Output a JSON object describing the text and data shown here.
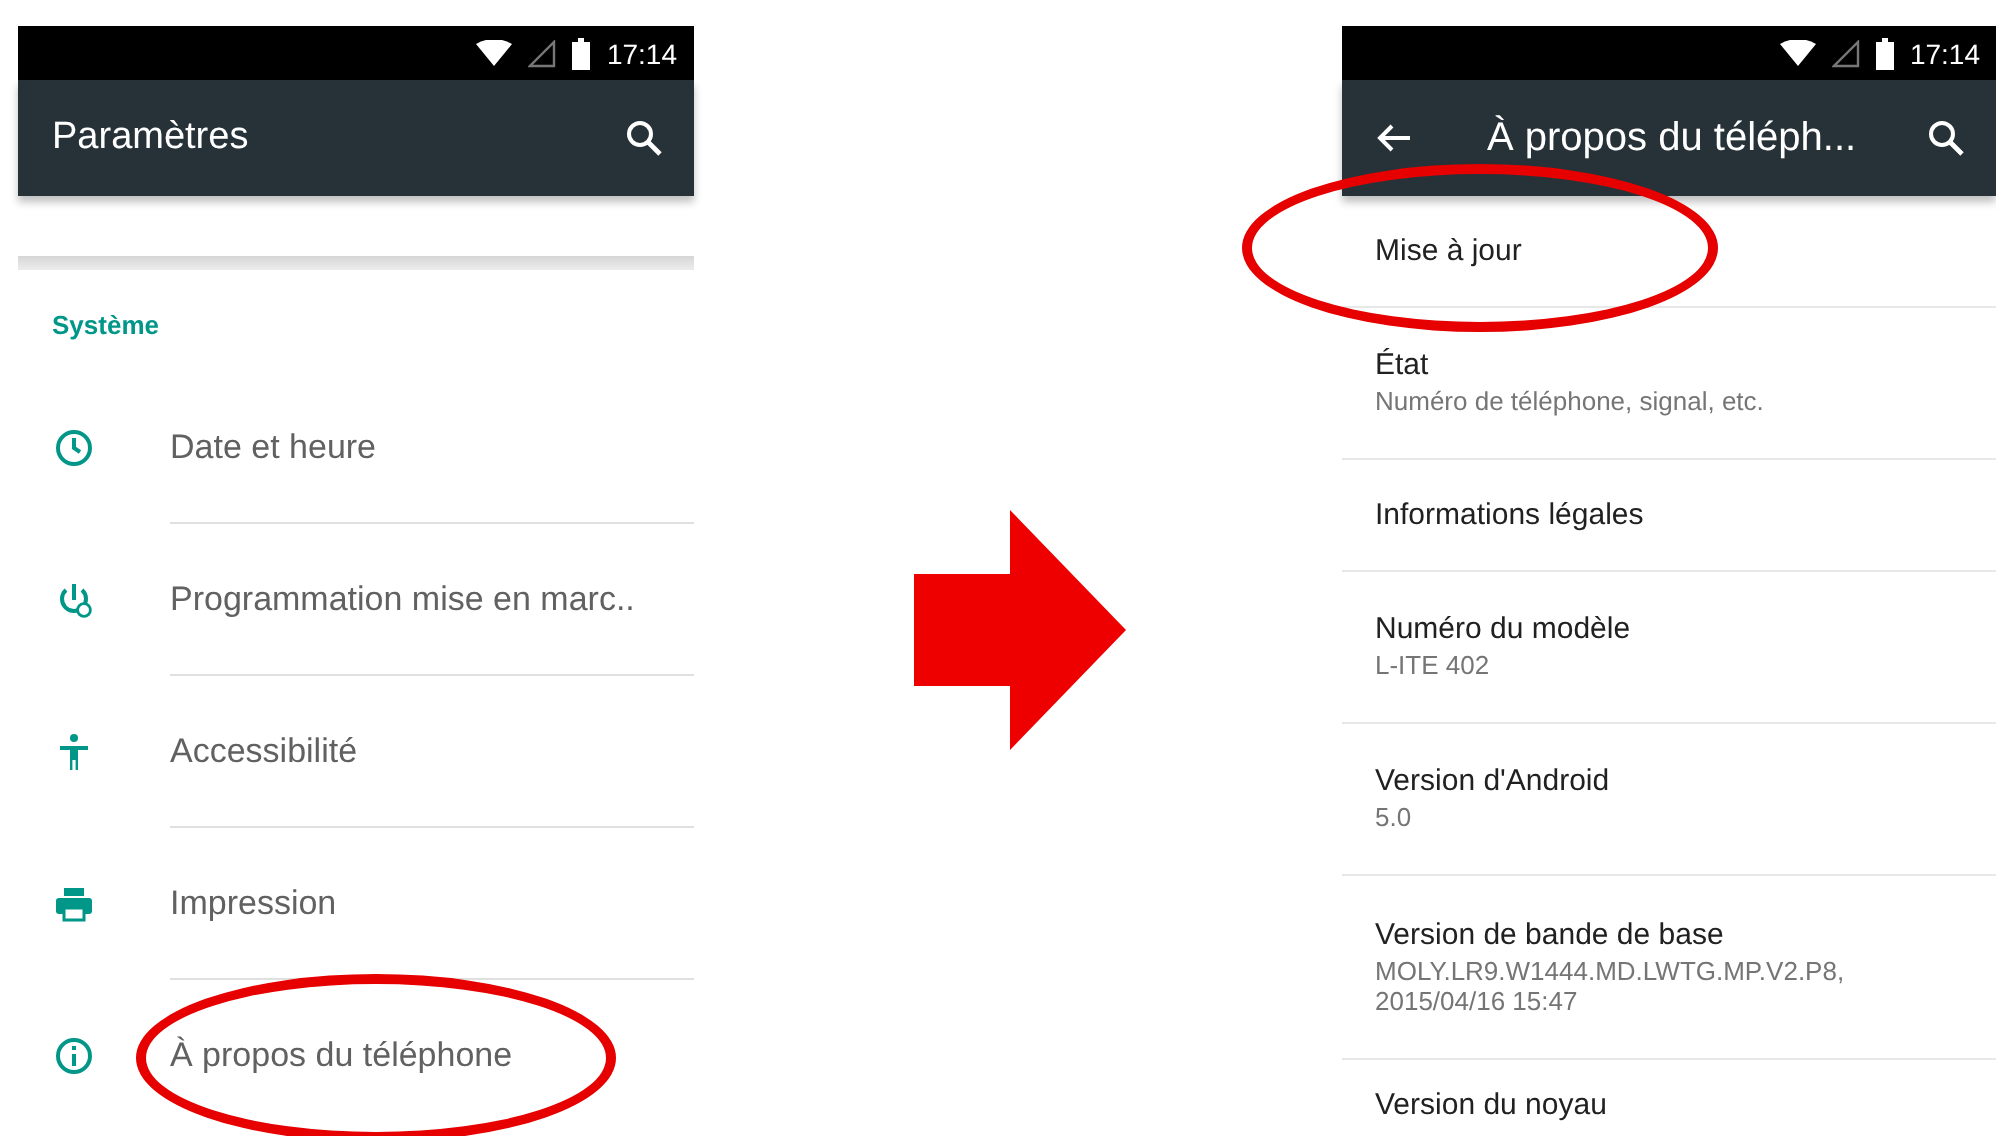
{
  "left_screen": {
    "status_bar": {
      "time": "17:14"
    },
    "app_bar": {
      "title": "Paramètres"
    },
    "section": "Système",
    "items": [
      {
        "kind": "clock",
        "label": "Date et heure",
        "circled": false
      },
      {
        "kind": "power-clock",
        "label": "Programmation mise en marc..",
        "circled": false
      },
      {
        "kind": "accessibility",
        "label": "Accessibilité",
        "circled": false
      },
      {
        "kind": "printer",
        "label": "Impression",
        "circled": false
      },
      {
        "kind": "info",
        "label": "À propos du téléphone",
        "circled": true
      }
    ]
  },
  "right_screen": {
    "status_bar": {
      "time": "17:14"
    },
    "app_bar": {
      "title": "À propos du téléph..."
    },
    "items": [
      {
        "title": "Mise à jour",
        "circled": true
      },
      {
        "title": "État",
        "summary": "Numéro de téléphone, signal, etc.",
        "circled": false
      },
      {
        "title": "Informations légales",
        "circled": false
      },
      {
        "title": "Numéro du modèle",
        "summary": "L-ITE 402",
        "circled": false
      },
      {
        "title": "Version d'Android",
        "summary": "5.0",
        "circled": false
      },
      {
        "title": "Version de bande de base",
        "summary": "MOLY.LR9.W1444.MD.LWTG.MP.V2.P8, 2015/04/16 15:47",
        "circled": false
      },
      {
        "title": "Version du noyau",
        "circled": false
      }
    ]
  }
}
